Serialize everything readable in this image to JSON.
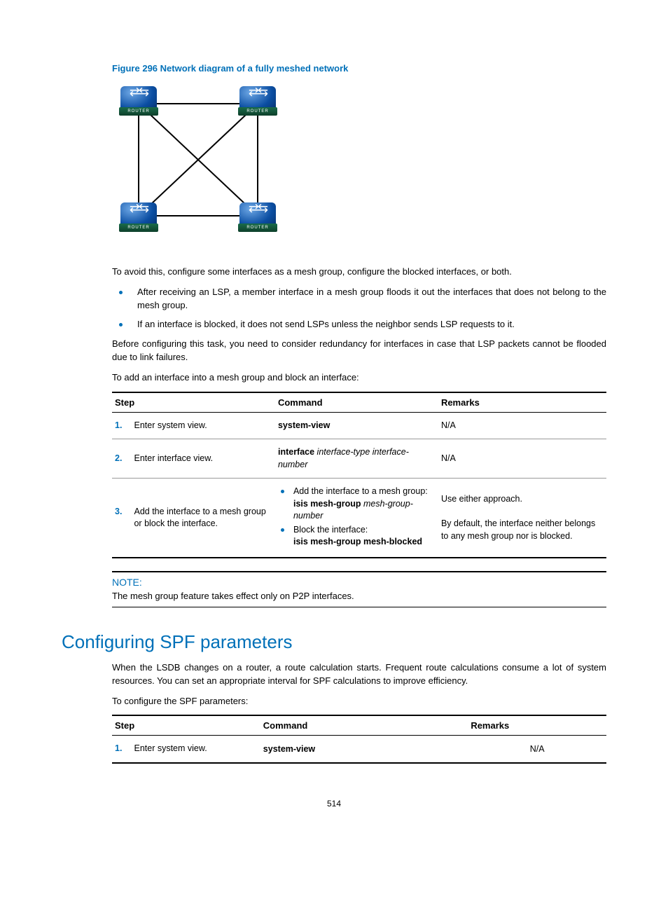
{
  "figure": {
    "caption": "Figure 296 Network diagram of a fully meshed network",
    "router_label": "ROUTER"
  },
  "intro": "To avoid this, configure some interfaces as a mesh group, configure the blocked interfaces, or both.",
  "bullets": [
    "After receiving an LSP, a member interface in a mesh group floods it out the interfaces that does not belong to the mesh group.",
    "If an interface is blocked, it does not send LSPs unless the neighbor sends LSP requests to it."
  ],
  "para2": "Before configuring this task, you need to consider redundancy for interfaces in case that LSP packets cannot be flooded due to link failures.",
  "para3": "To add an interface into a mesh group and block an interface:",
  "table1": {
    "headers": {
      "step": "Step",
      "command": "Command",
      "remarks": "Remarks"
    },
    "rows": [
      {
        "num": "1.",
        "desc": "Enter system view.",
        "cmd_bold": "system-view",
        "remarks": "N/A"
      },
      {
        "num": "2.",
        "desc": "Enter interface view.",
        "cmd_bold": "interface",
        "cmd_ital": " interface-type interface-number",
        "remarks": "N/A"
      },
      {
        "num": "3.",
        "desc": "Add the interface to a mesh group or block the interface.",
        "cmd_items": [
          {
            "text": "Add the interface to a mesh group:",
            "bold": "isis mesh-group",
            "ital": " mesh-group-number"
          },
          {
            "text": "Block the interface:",
            "bold": "isis mesh-group mesh-blocked"
          }
        ],
        "remarks_lines": [
          "Use either approach.",
          "By default, the interface neither belongs to any mesh group nor is blocked."
        ]
      }
    ]
  },
  "note": {
    "label": "NOTE:",
    "text": "The mesh group feature takes effect only on P2P interfaces."
  },
  "section_title": "Configuring SPF parameters",
  "spf_para1": "When the LSDB changes on a router, a route calculation starts. Frequent route calculations consume a lot of system resources. You can set an appropriate interval for SPF calculations to improve efficiency.",
  "spf_para2": "To configure the SPF parameters:",
  "table2": {
    "headers": {
      "step": "Step",
      "command": "Command",
      "remarks": "Remarks"
    },
    "rows": [
      {
        "num": "1.",
        "desc": "Enter system view.",
        "cmd_bold": "system-view",
        "remarks": "N/A"
      }
    ]
  },
  "page_number": "514"
}
